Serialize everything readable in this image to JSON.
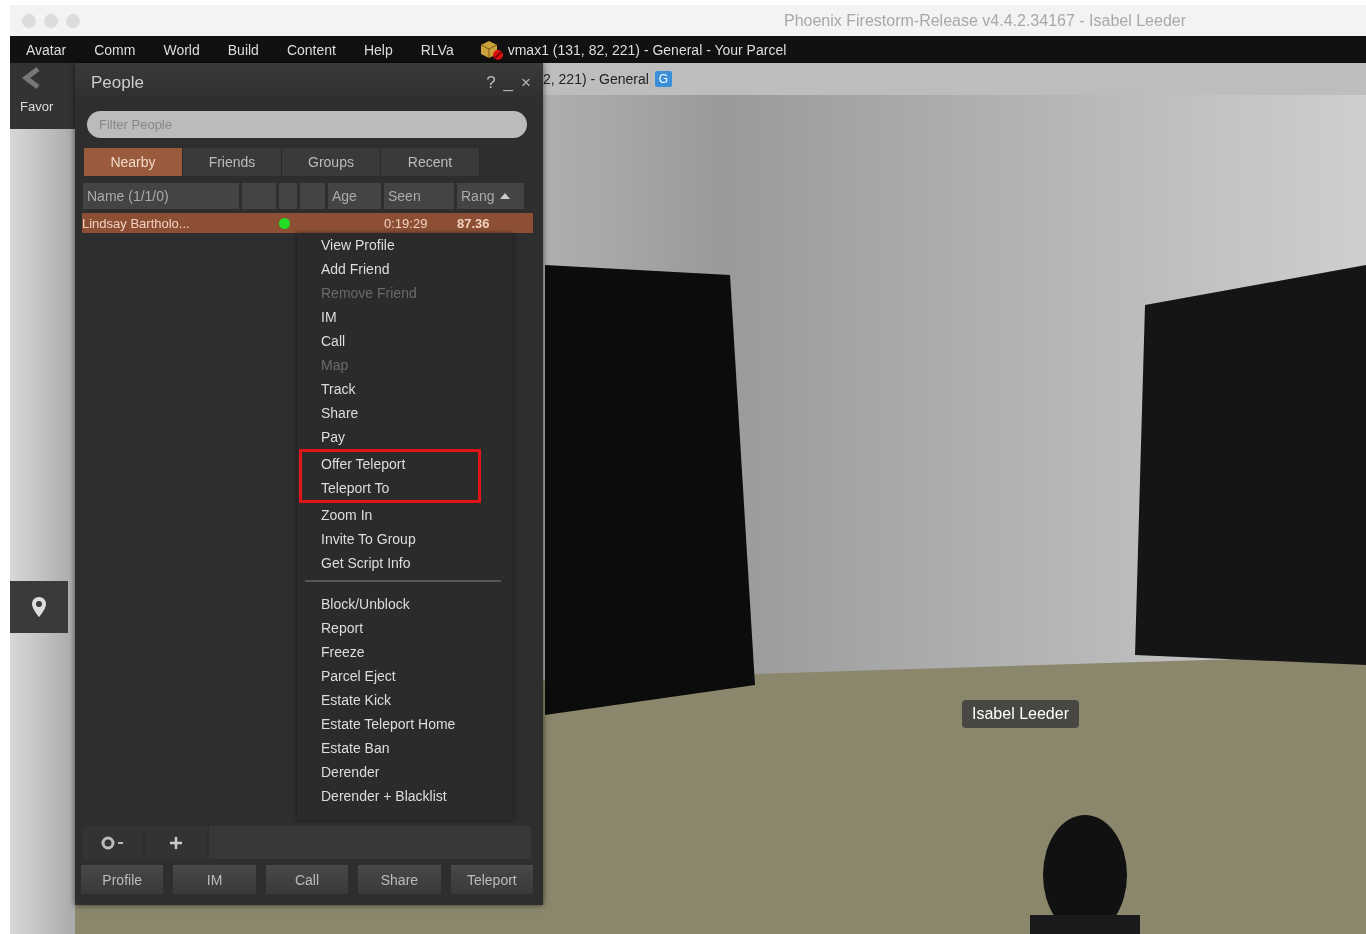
{
  "window": {
    "title": "Phoenix Firestorm-Release v4.4.2.34167 - Isabel Leeder",
    "focused": false
  },
  "menu_bar": {
    "items": [
      "Avatar",
      "Comm",
      "World",
      "Build",
      "Content",
      "Help",
      "RLVa"
    ],
    "location": "vmax1 (131, 82, 221) - General - Your Parcel"
  },
  "navigation_bar": {
    "location": "2, 221) - General",
    "maturity_badge": "G"
  },
  "side_toolbar": {
    "favorites_label": "Favor"
  },
  "people": {
    "title": "People",
    "title_buttons": [
      "?",
      "_",
      "×"
    ],
    "filter": {
      "placeholder": "Filter People"
    },
    "tabs": [
      {
        "label": "Nearby",
        "selected": true
      },
      {
        "label": "Friends",
        "selected": false
      },
      {
        "label": "Groups",
        "selected": false
      },
      {
        "label": "Recent",
        "selected": false
      }
    ],
    "columns": [
      {
        "kind": "text",
        "label": "Name (1/1/0)",
        "sorted": false
      },
      {
        "kind": "blank"
      },
      {
        "kind": "blank"
      },
      {
        "kind": "blank"
      },
      {
        "kind": "text",
        "label": "Age",
        "sorted": false
      },
      {
        "kind": "text",
        "label": "Seen",
        "sorted": false
      },
      {
        "kind": "text",
        "label": "Rang",
        "sorted": true
      }
    ],
    "rows": [
      {
        "name": "Lindsay Bartholo...",
        "online": true,
        "seen": "0:19:29",
        "range": "87.36",
        "selected": true
      }
    ],
    "context_menu": {
      "items": [
        {
          "kind": "item",
          "label": "View Profile",
          "disabled": false,
          "highlighted": false
        },
        {
          "kind": "item",
          "label": "Add Friend",
          "disabled": false,
          "highlighted": false
        },
        {
          "kind": "item",
          "label": "Remove Friend",
          "disabled": true,
          "highlighted": false
        },
        {
          "kind": "item",
          "label": "IM",
          "disabled": false,
          "highlighted": false
        },
        {
          "kind": "item",
          "label": "Call",
          "disabled": false,
          "highlighted": false
        },
        {
          "kind": "item",
          "label": "Map",
          "disabled": true,
          "highlighted": false
        },
        {
          "kind": "item",
          "label": "Track",
          "disabled": false,
          "highlighted": false
        },
        {
          "kind": "item",
          "label": "Share",
          "disabled": false,
          "highlighted": false
        },
        {
          "kind": "item",
          "label": "Pay",
          "disabled": false,
          "highlighted": false
        },
        {
          "kind": "item",
          "label": "Offer Teleport",
          "disabled": false,
          "highlighted": true
        },
        {
          "kind": "item",
          "label": "Teleport To",
          "disabled": false,
          "highlighted": true
        },
        {
          "kind": "item",
          "label": "Zoom In",
          "disabled": false,
          "highlighted": false
        },
        {
          "kind": "item",
          "label": "Invite To Group",
          "disabled": false,
          "highlighted": false
        },
        {
          "kind": "item",
          "label": "Get Script Info",
          "disabled": false,
          "highlighted": false
        },
        {
          "kind": "separator"
        },
        {
          "kind": "item",
          "label": "Block/Unblock",
          "disabled": false,
          "highlighted": false
        },
        {
          "kind": "item",
          "label": "Report",
          "disabled": false,
          "highlighted": false
        },
        {
          "kind": "item",
          "label": "Freeze",
          "disabled": false,
          "highlighted": false
        },
        {
          "kind": "item",
          "label": "Parcel Eject",
          "disabled": false,
          "highlighted": false
        },
        {
          "kind": "item",
          "label": "Estate Kick",
          "disabled": false,
          "highlighted": false
        },
        {
          "kind": "item",
          "label": "Estate Teleport Home",
          "disabled": false,
          "highlighted": false
        },
        {
          "kind": "item",
          "label": "Estate Ban",
          "disabled": false,
          "highlighted": false
        },
        {
          "kind": "item",
          "label": "Derender",
          "disabled": false,
          "highlighted": false
        },
        {
          "kind": "item",
          "label": "Derender + Blacklist",
          "disabled": false,
          "highlighted": false
        }
      ]
    },
    "buttons": [
      "Profile",
      "IM",
      "Call",
      "Share",
      "Teleport"
    ]
  },
  "scene": {
    "name_tag": "Isabel Leeder"
  }
}
